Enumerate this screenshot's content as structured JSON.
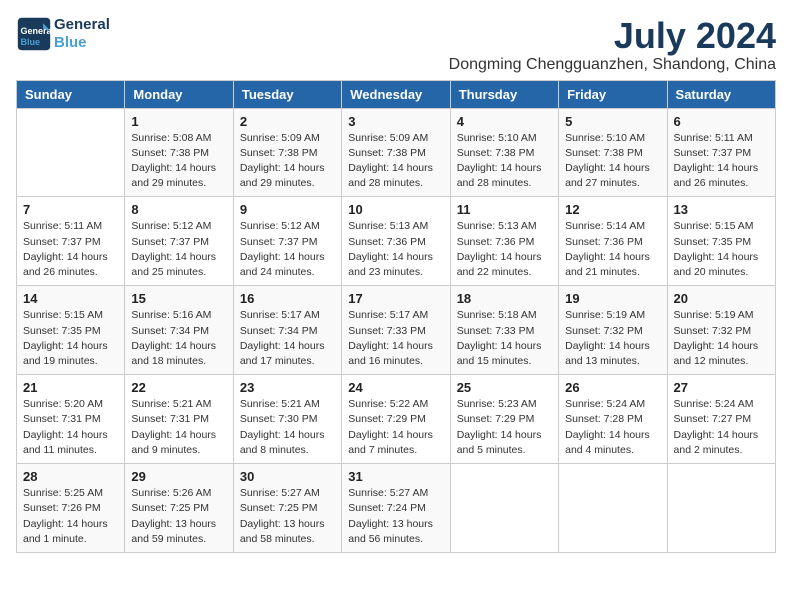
{
  "header": {
    "logo_line1": "General",
    "logo_line2": "Blue",
    "title": "July 2024",
    "subtitle": "Dongming Chengguanzhen, Shandong, China"
  },
  "weekdays": [
    "Sunday",
    "Monday",
    "Tuesday",
    "Wednesday",
    "Thursday",
    "Friday",
    "Saturday"
  ],
  "weeks": [
    [
      {
        "day": "",
        "info": ""
      },
      {
        "day": "1",
        "info": "Sunrise: 5:08 AM\nSunset: 7:38 PM\nDaylight: 14 hours\nand 29 minutes."
      },
      {
        "day": "2",
        "info": "Sunrise: 5:09 AM\nSunset: 7:38 PM\nDaylight: 14 hours\nand 29 minutes."
      },
      {
        "day": "3",
        "info": "Sunrise: 5:09 AM\nSunset: 7:38 PM\nDaylight: 14 hours\nand 28 minutes."
      },
      {
        "day": "4",
        "info": "Sunrise: 5:10 AM\nSunset: 7:38 PM\nDaylight: 14 hours\nand 28 minutes."
      },
      {
        "day": "5",
        "info": "Sunrise: 5:10 AM\nSunset: 7:38 PM\nDaylight: 14 hours\nand 27 minutes."
      },
      {
        "day": "6",
        "info": "Sunrise: 5:11 AM\nSunset: 7:37 PM\nDaylight: 14 hours\nand 26 minutes."
      }
    ],
    [
      {
        "day": "7",
        "info": "Sunrise: 5:11 AM\nSunset: 7:37 PM\nDaylight: 14 hours\nand 26 minutes."
      },
      {
        "day": "8",
        "info": "Sunrise: 5:12 AM\nSunset: 7:37 PM\nDaylight: 14 hours\nand 25 minutes."
      },
      {
        "day": "9",
        "info": "Sunrise: 5:12 AM\nSunset: 7:37 PM\nDaylight: 14 hours\nand 24 minutes."
      },
      {
        "day": "10",
        "info": "Sunrise: 5:13 AM\nSunset: 7:36 PM\nDaylight: 14 hours\nand 23 minutes."
      },
      {
        "day": "11",
        "info": "Sunrise: 5:13 AM\nSunset: 7:36 PM\nDaylight: 14 hours\nand 22 minutes."
      },
      {
        "day": "12",
        "info": "Sunrise: 5:14 AM\nSunset: 7:36 PM\nDaylight: 14 hours\nand 21 minutes."
      },
      {
        "day": "13",
        "info": "Sunrise: 5:15 AM\nSunset: 7:35 PM\nDaylight: 14 hours\nand 20 minutes."
      }
    ],
    [
      {
        "day": "14",
        "info": "Sunrise: 5:15 AM\nSunset: 7:35 PM\nDaylight: 14 hours\nand 19 minutes."
      },
      {
        "day": "15",
        "info": "Sunrise: 5:16 AM\nSunset: 7:34 PM\nDaylight: 14 hours\nand 18 minutes."
      },
      {
        "day": "16",
        "info": "Sunrise: 5:17 AM\nSunset: 7:34 PM\nDaylight: 14 hours\nand 17 minutes."
      },
      {
        "day": "17",
        "info": "Sunrise: 5:17 AM\nSunset: 7:33 PM\nDaylight: 14 hours\nand 16 minutes."
      },
      {
        "day": "18",
        "info": "Sunrise: 5:18 AM\nSunset: 7:33 PM\nDaylight: 14 hours\nand 15 minutes."
      },
      {
        "day": "19",
        "info": "Sunrise: 5:19 AM\nSunset: 7:32 PM\nDaylight: 14 hours\nand 13 minutes."
      },
      {
        "day": "20",
        "info": "Sunrise: 5:19 AM\nSunset: 7:32 PM\nDaylight: 14 hours\nand 12 minutes."
      }
    ],
    [
      {
        "day": "21",
        "info": "Sunrise: 5:20 AM\nSunset: 7:31 PM\nDaylight: 14 hours\nand 11 minutes."
      },
      {
        "day": "22",
        "info": "Sunrise: 5:21 AM\nSunset: 7:31 PM\nDaylight: 14 hours\nand 9 minutes."
      },
      {
        "day": "23",
        "info": "Sunrise: 5:21 AM\nSunset: 7:30 PM\nDaylight: 14 hours\nand 8 minutes."
      },
      {
        "day": "24",
        "info": "Sunrise: 5:22 AM\nSunset: 7:29 PM\nDaylight: 14 hours\nand 7 minutes."
      },
      {
        "day": "25",
        "info": "Sunrise: 5:23 AM\nSunset: 7:29 PM\nDaylight: 14 hours\nand 5 minutes."
      },
      {
        "day": "26",
        "info": "Sunrise: 5:24 AM\nSunset: 7:28 PM\nDaylight: 14 hours\nand 4 minutes."
      },
      {
        "day": "27",
        "info": "Sunrise: 5:24 AM\nSunset: 7:27 PM\nDaylight: 14 hours\nand 2 minutes."
      }
    ],
    [
      {
        "day": "28",
        "info": "Sunrise: 5:25 AM\nSunset: 7:26 PM\nDaylight: 14 hours\nand 1 minute."
      },
      {
        "day": "29",
        "info": "Sunrise: 5:26 AM\nSunset: 7:25 PM\nDaylight: 13 hours\nand 59 minutes."
      },
      {
        "day": "30",
        "info": "Sunrise: 5:27 AM\nSunset: 7:25 PM\nDaylight: 13 hours\nand 58 minutes."
      },
      {
        "day": "31",
        "info": "Sunrise: 5:27 AM\nSunset: 7:24 PM\nDaylight: 13 hours\nand 56 minutes."
      },
      {
        "day": "",
        "info": ""
      },
      {
        "day": "",
        "info": ""
      },
      {
        "day": "",
        "info": ""
      }
    ]
  ]
}
